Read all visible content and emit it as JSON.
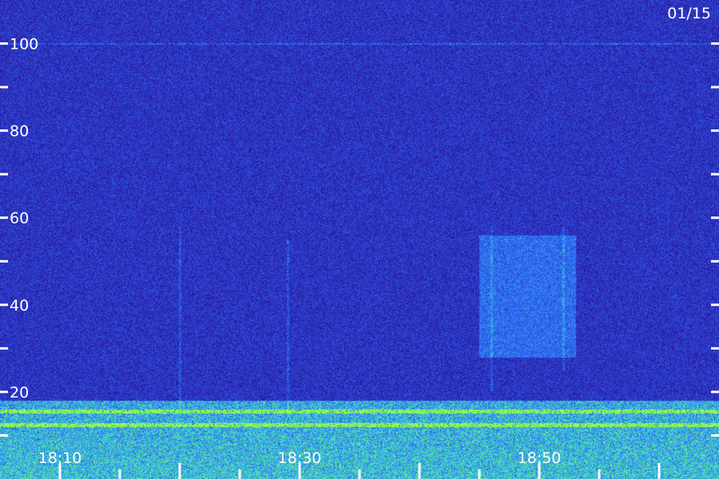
{
  "date_label": "01/15",
  "chart_data": {
    "type": "heatmap",
    "title": "",
    "xlabel": "",
    "ylabel": "",
    "x_range": [
      "18:05",
      "19:05"
    ],
    "x_tick_labels": [
      {
        "time": "18:10",
        "label": "18:10"
      },
      {
        "time": "18:30",
        "label": "18:30"
      },
      {
        "time": "18:50",
        "label": "18:50"
      }
    ],
    "x_minor_tick_interval_minutes": 5,
    "ylim": [
      0,
      110
    ],
    "y_tick_labels": [
      {
        "value": 20,
        "label": "20"
      },
      {
        "value": 40,
        "label": "40"
      },
      {
        "value": 60,
        "label": "60"
      },
      {
        "value": 80,
        "label": "80"
      },
      {
        "value": 100,
        "label": "100"
      }
    ],
    "y_minor_tick_interval": 10,
    "colors": {
      "background": "#1a0e5a",
      "low": "#2a1aa0",
      "mid": "#2f6cff",
      "high": "#3fe0c8",
      "peak": "#9cff3a"
    },
    "features": [
      {
        "name": "dense emission band",
        "y_range": [
          0,
          18
        ],
        "time_range": [
          "18:05",
          "19:05"
        ]
      },
      {
        "name": "bright emission line",
        "y": 15.5,
        "time_range": [
          "18:05",
          "19:05"
        ]
      },
      {
        "name": "bright emission line",
        "y": 12.5,
        "time_range": [
          "18:05",
          "19:05"
        ]
      },
      {
        "name": "faint line",
        "y": 100,
        "time_range": [
          "18:05",
          "19:05"
        ]
      },
      {
        "name": "enhanced emission patch",
        "y_range": [
          28,
          56
        ],
        "time_range": [
          "18:45",
          "18:53"
        ]
      },
      {
        "name": "vertical striation",
        "time": "18:20",
        "y_range": [
          15,
          58
        ]
      },
      {
        "name": "vertical striation",
        "time": "18:29",
        "y_range": [
          15,
          55
        ]
      },
      {
        "name": "vertical striation",
        "time": "18:46",
        "y_range": [
          20,
          58
        ]
      },
      {
        "name": "vertical striation",
        "time": "18:52",
        "y_range": [
          25,
          58
        ]
      }
    ]
  }
}
